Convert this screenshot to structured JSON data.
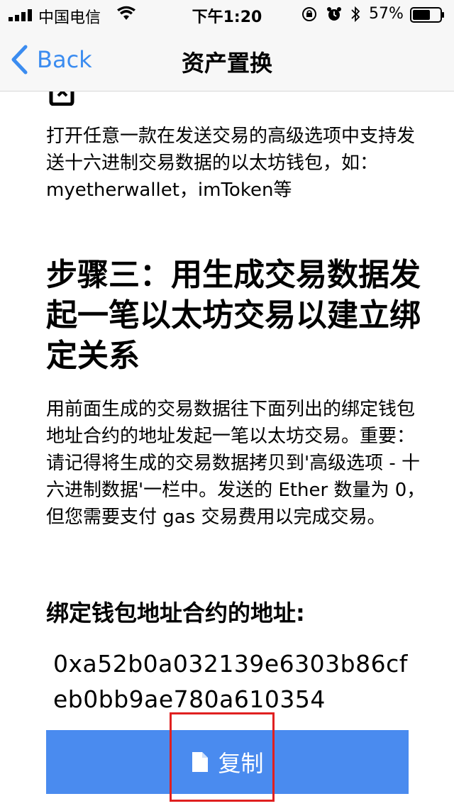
{
  "status_bar": {
    "carrier": "中国电信",
    "time": "下午1:20",
    "battery_percent": "57%"
  },
  "nav": {
    "back_label": "Back",
    "title": "资产置换"
  },
  "content": {
    "wallet_hint": "打开任意一款在发送交易的高级选项中支持发送十六进制交易数据的以太坊钱包，如：myetherwallet，imToken等",
    "step3_heading": "步骤三：用生成交易数据发起一笔以太坊交易以建立绑定关系",
    "step3_description": "用前面生成的交易数据往下面列出的绑定钱包地址合约的地址发起一笔以太坊交易。重要：请记得将生成的交易数据拷贝到'高级选项 - 十六进制数据'一栏中。发送的 Ether 数量为 0，但您需要支付 gas 交易费用以完成交易。",
    "address_label": "绑定钱包地址合约的地址:",
    "address_value": "0xa52b0a032139e6303b86cfeb0bb9ae780a610354",
    "copy_label": "复制"
  },
  "colors": {
    "accent": "#3b8cf0",
    "button_bg": "#4a8bef",
    "highlight": "#e02020"
  }
}
